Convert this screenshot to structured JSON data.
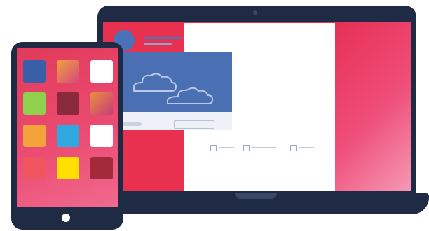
{
  "colors": {
    "device_frame": "#1f2a44",
    "screen_red": "#e8314f",
    "screen_pink": "#ef4f7a",
    "post_blue": "#4a72b8",
    "post_image_blue": "#4a6fb3",
    "card_white": "#ffffff"
  },
  "tablet": {
    "app_icons": [
      {
        "icon": "app-icon",
        "color": "#3a5fa8"
      },
      {
        "icon": "app-icon",
        "color": "linear-gradient(135deg,#f0a040,#d44a7a)"
      },
      {
        "icon": "app-icon",
        "color": "#ffffff"
      },
      {
        "icon": "app-icon",
        "color": "#8fd14f"
      },
      {
        "icon": "app-icon",
        "color": "#8b2a3a"
      },
      {
        "icon": "app-icon",
        "color": "linear-gradient(135deg,#e98d45,#c73d75)"
      },
      {
        "icon": "app-icon",
        "color": "#f2a33a"
      },
      {
        "icon": "app-icon",
        "color": "#2fa8e0"
      },
      {
        "icon": "app-icon",
        "color": "#ffffff"
      },
      {
        "icon": "app-icon",
        "color": "#f0545f"
      },
      {
        "icon": "app-icon",
        "color": "#ffe000"
      },
      {
        "icon": "app-icon",
        "color": "#a32a3a"
      }
    ]
  },
  "post": {
    "actions": [
      {
        "icon": "like-icon"
      },
      {
        "icon": "comment-icon"
      },
      {
        "icon": "share-icon"
      }
    ]
  }
}
